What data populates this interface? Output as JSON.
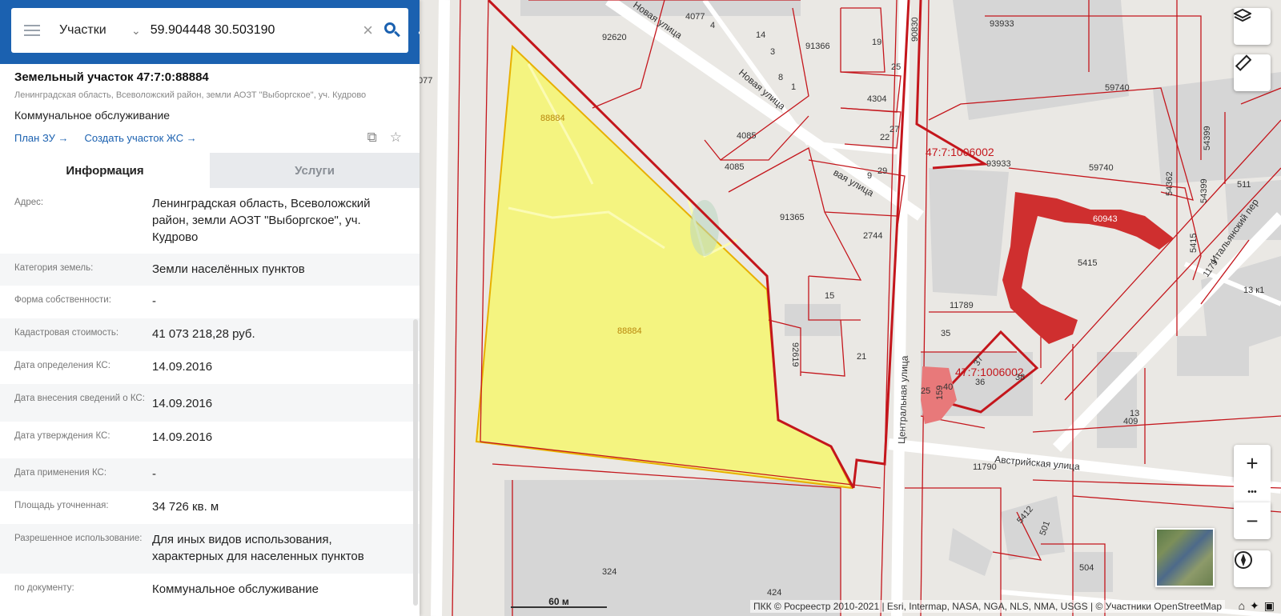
{
  "search": {
    "type_label": "Участки",
    "query": "59.904448 30.503190"
  },
  "plot": {
    "title": "Земельный участок 47:7:0:88884",
    "address_short": "Ленинградская область, Всеволожский район, земли АОЗТ \"Выборгское\", уч. Кудрово",
    "use": "Коммунальное обслуживание",
    "link_plan": "План ЗУ →",
    "link_create": "Создать участок ЖС →"
  },
  "tabs": {
    "info": "Информация",
    "services": "Услуги"
  },
  "info_rows": [
    {
      "label": "Адрес:",
      "value": "Ленинградская область, Всеволожский район, земли АОЗТ \"Выборгское\", уч. Кудрово"
    },
    {
      "label": "Категория земель:",
      "value": "Земли населённых пунктов"
    },
    {
      "label": "Форма собственности:",
      "value": "-"
    },
    {
      "label": "Кадастровая стоимость:",
      "value": "41 073 218,28 руб."
    },
    {
      "label": "Дата определения КС:",
      "value": "14.09.2016"
    },
    {
      "label": "Дата внесения сведений о КС:",
      "value": "14.09.2016"
    },
    {
      "label": "Дата утверждения КС:",
      "value": "14.09.2016"
    },
    {
      "label": "Дата применения КС:",
      "value": "-"
    },
    {
      "label": "Площадь уточненная:",
      "value": "34 726 кв. м"
    },
    {
      "label": "Разрешенное использование:",
      "value": "Для иных видов использования, характерных для населенных пунктов"
    },
    {
      "label": "по документу:",
      "value": "Коммунальное обслуживание"
    }
  ],
  "map": {
    "labels": {
      "plot_top": "88884",
      "plot_center": "88884",
      "l077": "077",
      "l92620": "92620",
      "l4077": "4077",
      "l4": "4",
      "l14": "14",
      "l3": "3",
      "l8": "8",
      "l1": "1",
      "l91366": "91366",
      "l19": "19",
      "l25a": "25",
      "l90830": "90830",
      "l93933": "93933",
      "l59740a": "59740",
      "l4304": "4304",
      "l4085a": "4085",
      "l4085b": "4085",
      "l27": "27",
      "l22": "22",
      "l9": "9",
      "l29": "29",
      "block1": "47:7:1006002",
      "l9393b": "93933",
      "l59740b": "59740",
      "l91365": "91365",
      "l2744": "2744",
      "l15": "15",
      "l60943": "60943",
      "l5415a": "5415",
      "l11789": "11789",
      "l35": "35",
      "l21": "21",
      "l92619": "92619",
      "block2": "47:7:1006002",
      "l37": "37",
      "l40": "40",
      "l36": "36",
      "l38": "38",
      "l25b": "25",
      "l159": "159",
      "l11790": "11790",
      "l13": "13",
      "l409": "409",
      "l13k1": "13 к1",
      "l511": "511",
      "l54362": "54362",
      "l54399a": "54399",
      "l54399b": "54399",
      "l5415b": "5415",
      "l1179": "1179",
      "l5412": "5412",
      "l501": "501",
      "l504": "504",
      "l324": "324",
      "l424": "424",
      "street_novaya1": "Новая улица",
      "street_novaya2": "Новая улица",
      "street_novaya3": "вая улица",
      "street_central": "Центральная улица",
      "street_austr": "Австрийская улица",
      "street_ital": "Итальянский пер"
    },
    "scale": "60 м",
    "attribution": "ПКК © Росреестр 2010-2021 | Esri, Intermap, NASA, NGA, NLS, NMA, USGS | © Участники OpenStreetMap",
    "zoom_in": "+",
    "zoom_more": "•••",
    "zoom_out": "−",
    "colors": {
      "plot_fill": "#f4f47a",
      "boundary": "#c4161c",
      "building": "#d2d2d2",
      "red_building": "#cf2f2f"
    }
  }
}
